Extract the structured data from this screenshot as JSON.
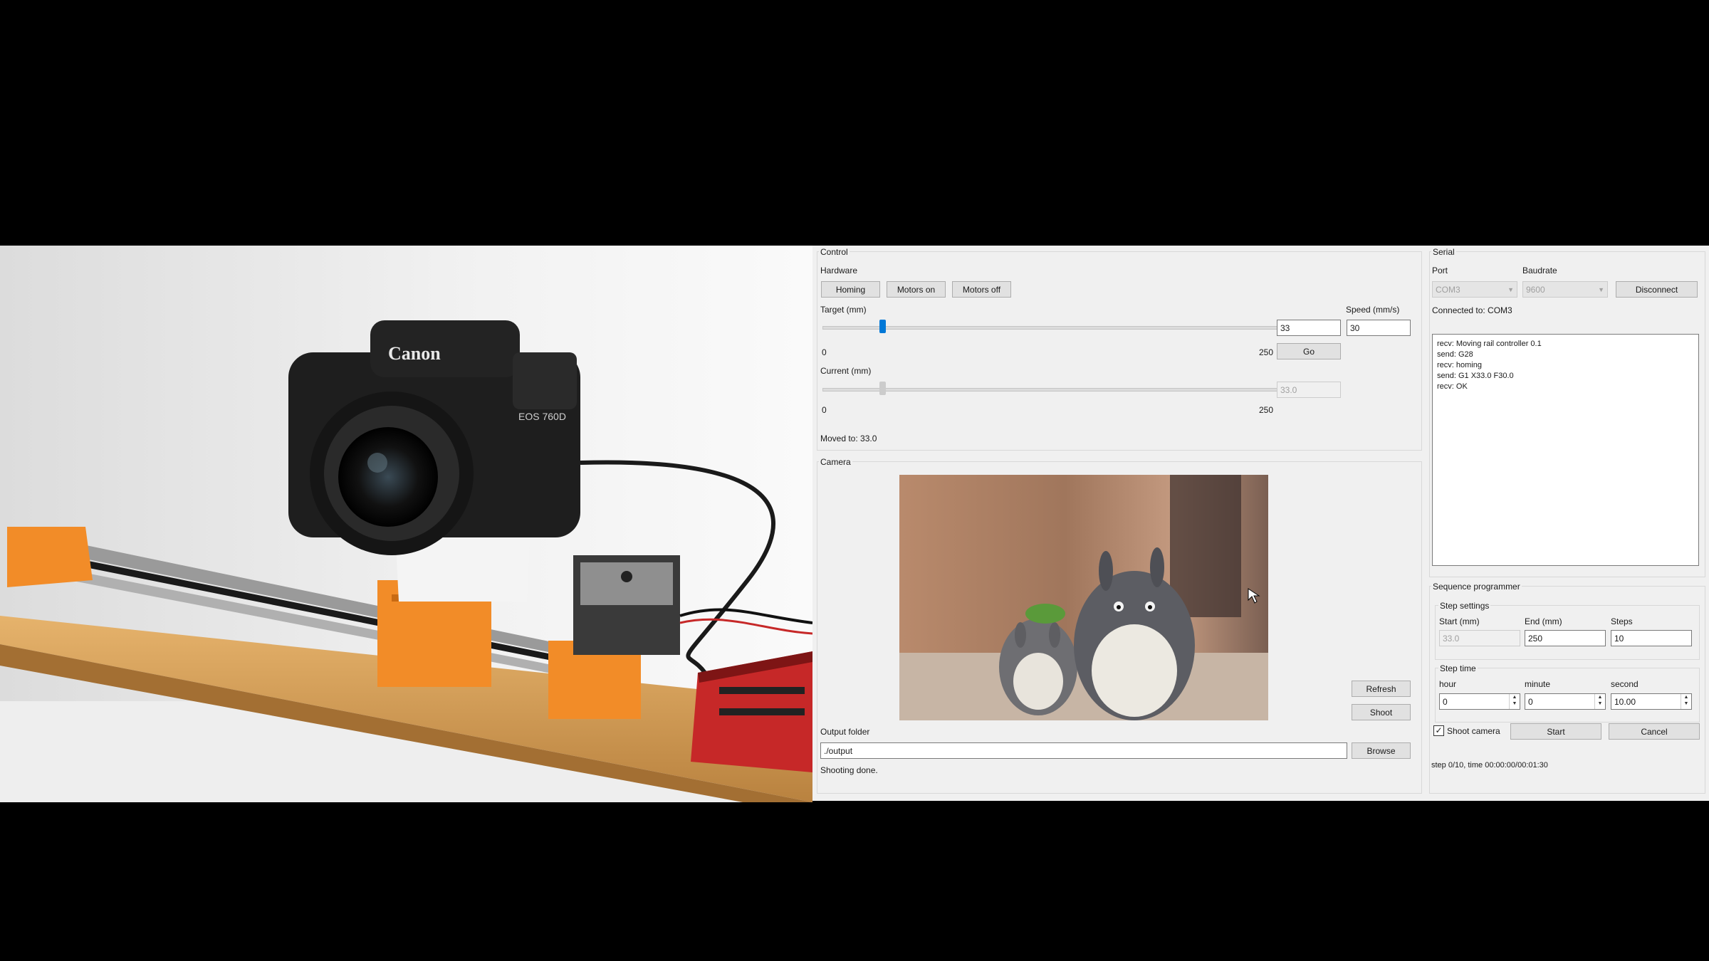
{
  "control": {
    "title": "Control",
    "hardware": {
      "label": "Hardware",
      "homing": "Homing",
      "motors_on": "Motors on",
      "motors_off": "Motors off"
    },
    "target": {
      "label": "Target (mm)",
      "min": "0",
      "max": "250",
      "value": "33",
      "fraction": 0.132
    },
    "speed": {
      "label": "Speed (mm/s)",
      "value": "30"
    },
    "go": "Go",
    "current": {
      "label": "Current (mm)",
      "min": "0",
      "max": "250",
      "value": "33.0",
      "fraction": 0.132
    },
    "status": "Moved to: 33.0"
  },
  "camera": {
    "title": "Camera",
    "refresh": "Refresh",
    "shoot": "Shoot",
    "output_label": "Output folder",
    "output_path": "./output",
    "browse": "Browse",
    "status": "Shooting done."
  },
  "serial": {
    "title": "Serial",
    "port_label": "Port",
    "port_value": "COM3",
    "baud_label": "Baudrate",
    "baud_value": "9600",
    "disconnect": "Disconnect",
    "connected": "Connected to: COM3",
    "log": [
      "recv: Moving rail controller 0.1",
      "send: G28",
      "recv: homing",
      "send: G1 X33.0 F30.0",
      "recv: OK"
    ]
  },
  "sequence": {
    "title": "Sequence programmer",
    "step_settings": "Step settings",
    "start_label": "Start (mm)",
    "start_value": "33.0",
    "end_label": "End (mm)",
    "end_value": "250",
    "steps_label": "Steps",
    "steps_value": "10",
    "step_time": "Step time",
    "hour_label": "hour",
    "hour_value": "0",
    "minute_label": "minute",
    "minute_value": "0",
    "second_label": "second",
    "second_value": "10.00",
    "shoot_camera": "Shoot camera",
    "start_btn": "Start",
    "cancel_btn": "Cancel",
    "progress": "step 0/10, time 00:00:00/00:01:30"
  },
  "photo_text": {
    "brand": "Canon",
    "model": "EOS 760D"
  },
  "colors": {
    "accent": "#0078d7",
    "window_bg": "#f0f0f0"
  }
}
